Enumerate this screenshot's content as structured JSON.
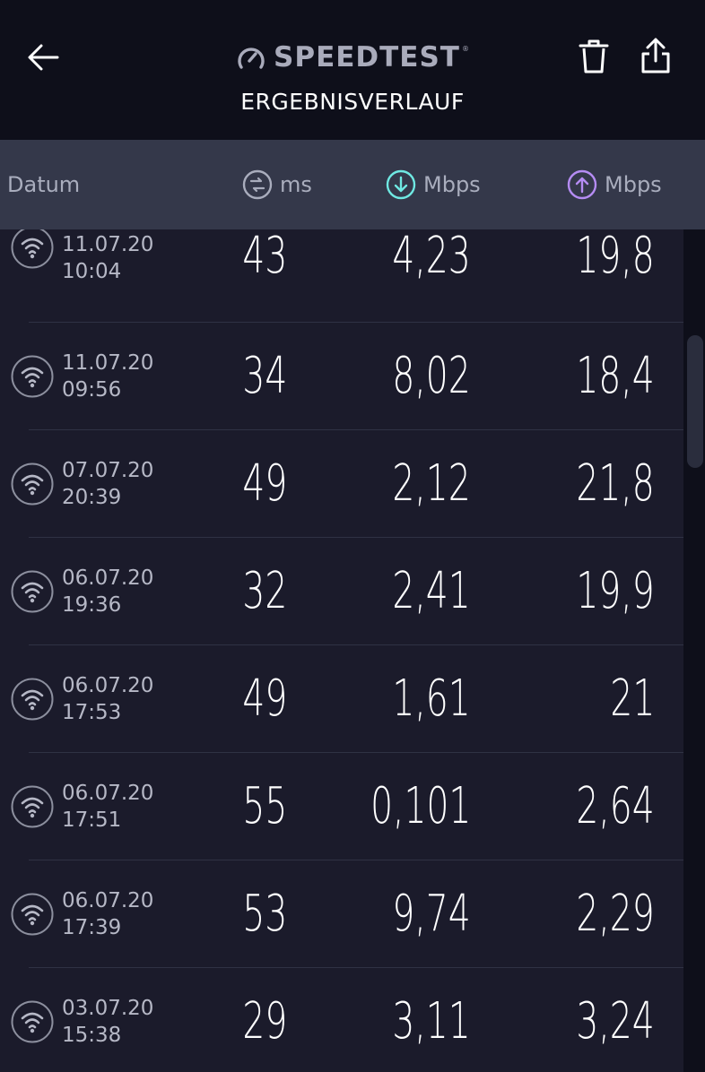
{
  "header": {
    "brand": "SPEEDTEST",
    "trademark": "®",
    "title": "ERGEBNISVERLAUF"
  },
  "columns": {
    "date": "Datum",
    "ping_unit": "ms",
    "download_unit": "Mbps",
    "upload_unit": "Mbps"
  },
  "colors": {
    "download_accent": "#6fe8e2",
    "upload_accent": "#b58cf3",
    "ping_icon": "#a9adbd"
  },
  "rows": [
    {
      "date": "11.07.20",
      "time": "10:04",
      "ping": "43",
      "download": "4,23",
      "upload": "19,8",
      "icon": "wifi-icon"
    },
    {
      "date": "11.07.20",
      "time": "09:56",
      "ping": "34",
      "download": "8,02",
      "upload": "18,4",
      "icon": "wifi-icon"
    },
    {
      "date": "07.07.20",
      "time": "20:39",
      "ping": "49",
      "download": "2,12",
      "upload": "21,8",
      "icon": "wifi-icon"
    },
    {
      "date": "06.07.20",
      "time": "19:36",
      "ping": "32",
      "download": "2,41",
      "upload": "19,9",
      "icon": "wifi-icon"
    },
    {
      "date": "06.07.20",
      "time": "17:53",
      "ping": "49",
      "download": "1,61",
      "upload": "21",
      "icon": "wifi-icon"
    },
    {
      "date": "06.07.20",
      "time": "17:51",
      "ping": "55",
      "download": "0,101",
      "upload": "2,64",
      "icon": "wifi-icon"
    },
    {
      "date": "06.07.20",
      "time": "17:39",
      "ping": "53",
      "download": "9,74",
      "upload": "2,29",
      "icon": "wifi-icon"
    },
    {
      "date": "03.07.20",
      "time": "15:38",
      "ping": "29",
      "download": "3,11",
      "upload": "3,24",
      "icon": "wifi-icon"
    }
  ]
}
